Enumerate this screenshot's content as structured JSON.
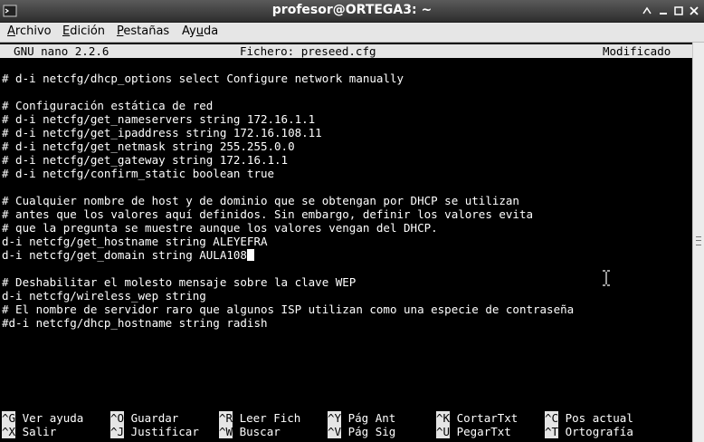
{
  "window": {
    "title": "profesor@ORTEGA3: ~"
  },
  "menu": {
    "archivo": {
      "u": "A",
      "rest": "rchivo"
    },
    "edicion": {
      "u": "E",
      "rest": "dición"
    },
    "pestanas": {
      "u": "P",
      "rest": "estañas"
    },
    "ayuda": {
      "pre": "Ay",
      "u": "u",
      "rest": "da"
    }
  },
  "nano": {
    "version": "  GNU nano 2.2.6",
    "file": "Fichero: preseed.cfg",
    "status": "Modificado"
  },
  "lines": [
    "# d-i netcfg/dhcp_options select Configure network manually",
    "# Configuración estática de red",
    "# d-i netcfg/get_nameservers string 172.16.1.1",
    "# d-i netcfg/get_ipaddress string 172.16.108.11",
    "# d-i netcfg/get_netmask string 255.255.0.0",
    "# d-i netcfg/get_gateway string 172.16.1.1",
    "# d-i netcfg/confirm_static boolean true",
    "# Cualquier nombre de host y de dominio que se obtengan por DHCP se utilizan",
    "# antes que los valores aquí definidos. Sin embargo, definir los valores evita",
    "# que la pregunta se muestre aunque los valores vengan del DHCP.",
    "d-i netcfg/get_hostname string ALEYEFRA",
    "d-i netcfg/get_domain string AULA108",
    "# Deshabilitar el molesto mensaje sobre la clave WEP",
    "d-i netcfg/wireless_wep string",
    "# El nombre de servidor raro que algunos ISP utilizan como una especie de contraseña",
    "#d-i netcfg/dhcp_hostname string radish"
  ],
  "shortcuts": [
    {
      "key": "^G",
      "label": "Ver ayuda"
    },
    {
      "key": "^O",
      "label": "Guardar"
    },
    {
      "key": "^R",
      "label": "Leer Fich"
    },
    {
      "key": "^Y",
      "label": "Pág Ant"
    },
    {
      "key": "^K",
      "label": "CortarTxt"
    },
    {
      "key": "^C",
      "label": "Pos actual"
    },
    {
      "key": "^X",
      "label": "Salir"
    },
    {
      "key": "^J",
      "label": "Justificar"
    },
    {
      "key": "^W",
      "label": "Buscar"
    },
    {
      "key": "^V",
      "label": "Pág Sig"
    },
    {
      "key": "^U",
      "label": "PegarTxt"
    },
    {
      "key": "^T",
      "label": "Ortografía"
    }
  ],
  "colors": {
    "terminal_bg": "#000000",
    "terminal_fg": "#ffffff",
    "bar_bg": "#e5e5e5"
  },
  "icons": [
    "terminal-icon",
    "restore-icon",
    "minimize-icon",
    "maximize-icon",
    "close-icon",
    "ibeam-cursor-icon"
  ]
}
